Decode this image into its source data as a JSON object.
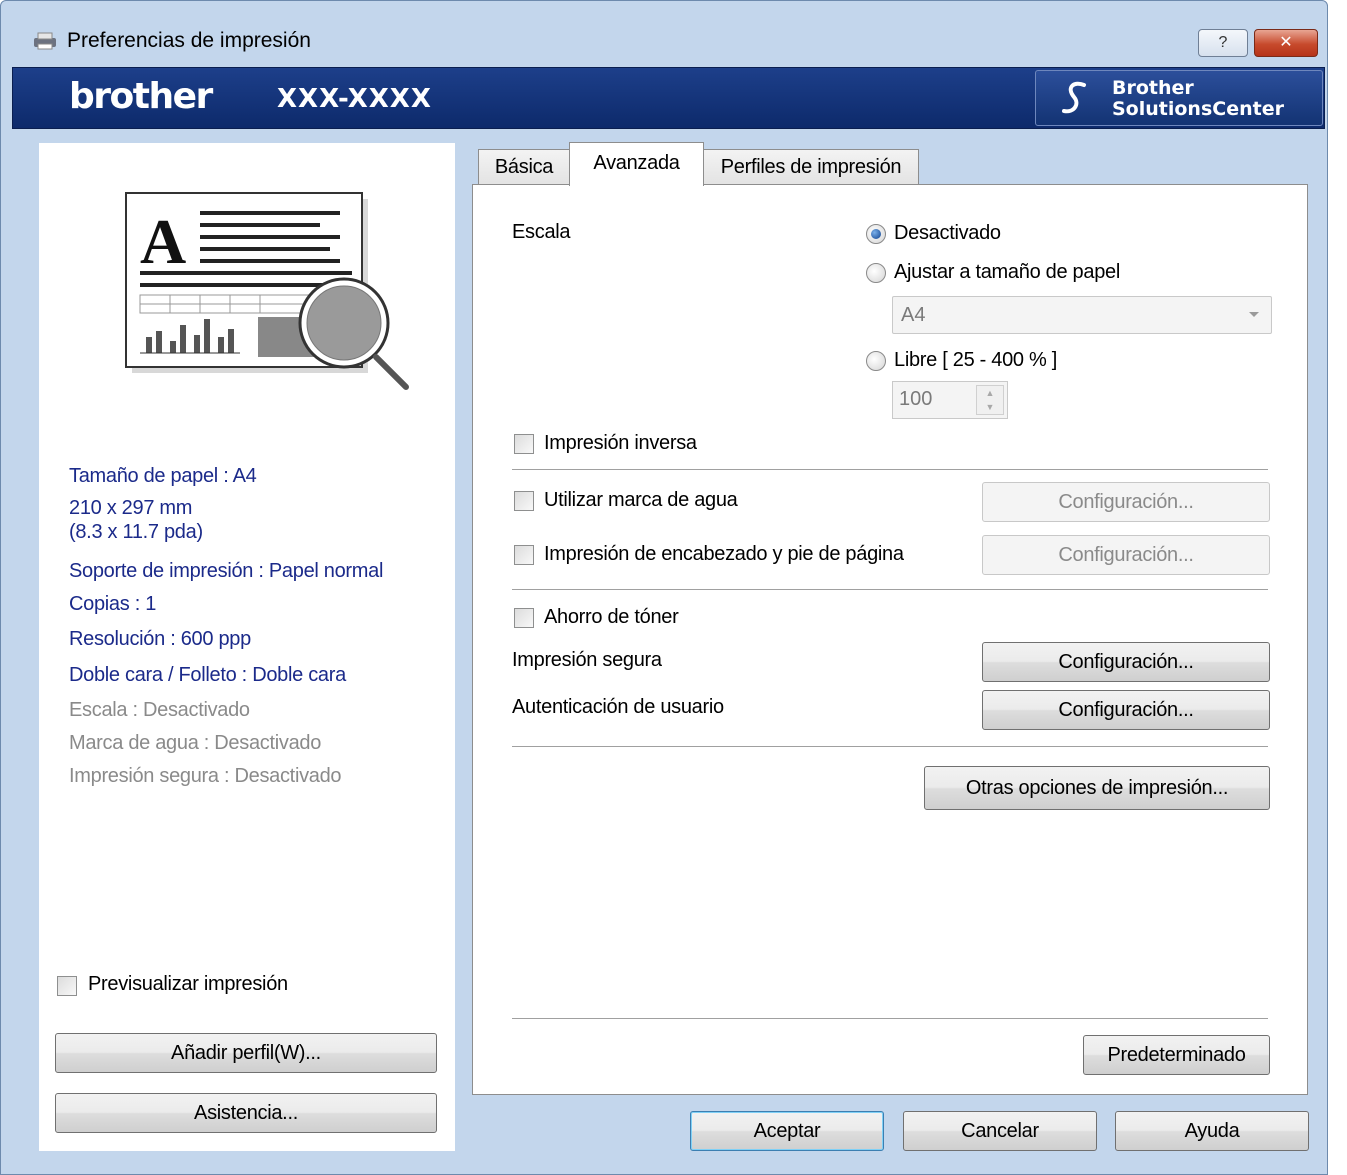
{
  "window": {
    "title": "Preferencias de impresión",
    "help_btn": "?",
    "close_btn": "✕"
  },
  "header": {
    "brand": "brother",
    "model": "XXX-XXXX",
    "solutions_line1": "Brother",
    "solutions_line2": "SolutionsCenter"
  },
  "summary": {
    "paper_size": "Tamaño de papel : A4",
    "dimensions_mm": "210 x 297 mm",
    "dimensions_in": "(8.3 x 11.7 pda)",
    "media": "Soporte de impresión : Papel normal",
    "copies": "Copias : 1",
    "resolution": "Resolución : 600 ppp",
    "duplex": "Doble cara / Folleto : Doble cara",
    "scale": "Escala : Desactivado",
    "watermark": "Marca de agua : Desactivado",
    "secure": "Impresión segura : Desactivado"
  },
  "left": {
    "preview_label": "Previsualizar impresión",
    "add_profile": "Añadir perfil(W)...",
    "support": "Asistencia..."
  },
  "tabs": [
    "Básica",
    "Avanzada",
    "Perfiles de impresión"
  ],
  "advanced": {
    "scale_label": "Escala",
    "radio_off": "Desactivado",
    "radio_fit": "Ajustar a tamaño de papel",
    "fit_select": "A4",
    "radio_free": "Libre [ 25 - 400 % ]",
    "free_value": "100",
    "reverse": "Impresión inversa",
    "watermark": "Utilizar marca de agua",
    "header_footer": "Impresión de encabezado y pie de página",
    "toner": "Ahorro de tóner",
    "secure": "Impresión segura",
    "auth": "Autenticación de usuario",
    "config": "Configuración...",
    "other": "Otras opciones de impresión...",
    "default": "Predeterminado"
  },
  "footer": {
    "ok": "Aceptar",
    "cancel": "Cancelar",
    "help": "Ayuda"
  },
  "colors": {
    "brand_bar": "#1d3f8a",
    "summary_text": "#1b2a8a",
    "window_frame": "#c3d6ec"
  }
}
